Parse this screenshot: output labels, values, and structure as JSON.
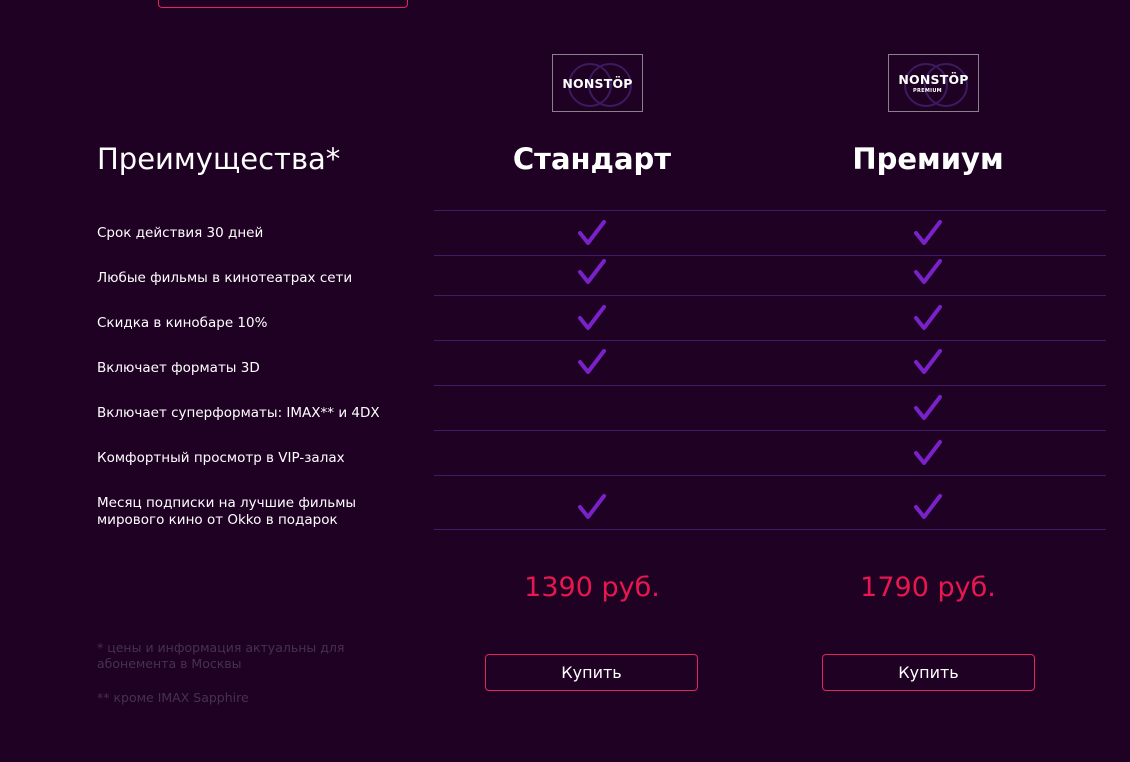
{
  "colors": {
    "background": "#1f0124",
    "accent": "#e0265a",
    "price": "#e8174f",
    "check": "#7a22c9",
    "divider": "#3e1b66",
    "footnote": "#463151"
  },
  "benefits": {
    "heading": "Преимущества*",
    "features": [
      "Срок действия 30 дней",
      "Любые фильмы в кинотеатрах сети",
      "Скидка в кинобаре 10%",
      "Включает форматы 3D",
      "Включает суперформаты: IMAX** и 4DX",
      "Комфортный просмотр в VIP-залах",
      "Месяц подписки на лучшие фильмы мирового кино от Okko в подарок"
    ]
  },
  "plans": [
    {
      "logo_text": "NONSTÖP",
      "logo_subtext": "",
      "title": "Стандарт",
      "included": [
        true,
        true,
        true,
        true,
        false,
        false,
        true
      ],
      "price": "1390 руб.",
      "buy_label": "Купить"
    },
    {
      "logo_text": "NONSTÖP",
      "logo_subtext": "PREMIUM",
      "title": "Премиум",
      "included": [
        true,
        true,
        true,
        true,
        true,
        true,
        true
      ],
      "price": "1790 руб.",
      "buy_label": "Купить"
    }
  ],
  "footnotes": {
    "prices_note": "* цены и информация актуальны для абонемента в Москвы",
    "imax_note": "** кроме IMAX Sapphire"
  }
}
